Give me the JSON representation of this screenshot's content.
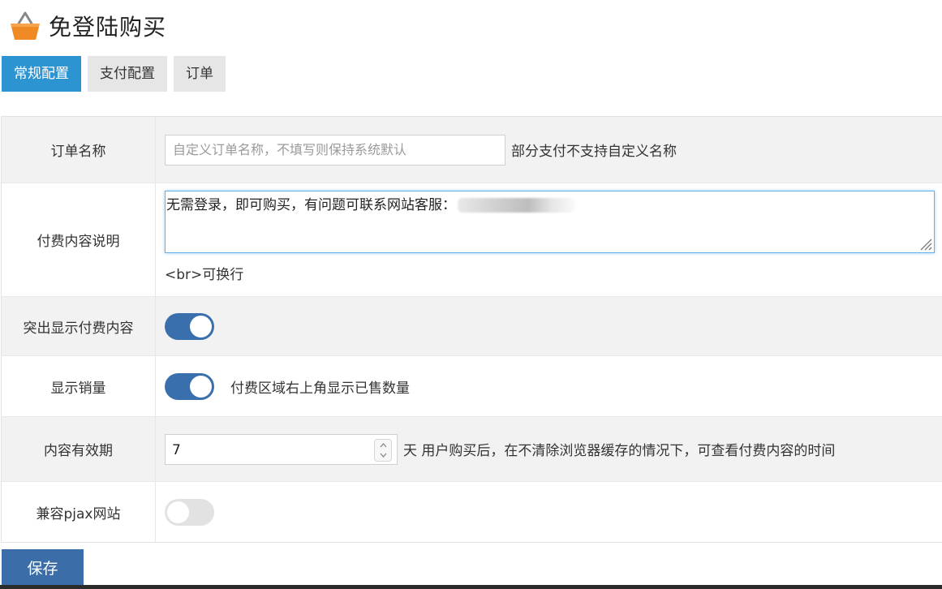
{
  "page": {
    "title": "免登陆购买",
    "icon": "shopping-basket-icon"
  },
  "tabs": [
    {
      "label": "常规配置",
      "active": true
    },
    {
      "label": "支付配置",
      "active": false
    },
    {
      "label": "订单",
      "active": false
    }
  ],
  "form": {
    "order_name": {
      "label": "订单名称",
      "placeholder": "自定义订单名称，不填写则保持系统默认",
      "value": "",
      "hint": "部分支付不支持自定义名称"
    },
    "paid_desc": {
      "label": "付费内容说明",
      "value": "无需登录，即可购买，有问题可联系网站客服：",
      "note": "<br>可换行"
    },
    "highlight_paid": {
      "label": "突出显示付费内容",
      "enabled": true
    },
    "show_sales": {
      "label": "显示销量",
      "enabled": true,
      "hint": "付费区域右上角显示已售数量"
    },
    "validity": {
      "label": "内容有效期",
      "value": "7",
      "hint": "天 用户购买后，在不清除浏览器缓存的情况下，可查看付费内容的时间"
    },
    "pjax": {
      "label": "兼容pjax网站",
      "enabled": false
    }
  },
  "actions": {
    "save_label": "保存"
  },
  "colors": {
    "accent": "#2d94d2",
    "toggle_on": "#3a6fae",
    "save_button": "#3b6ea8"
  }
}
